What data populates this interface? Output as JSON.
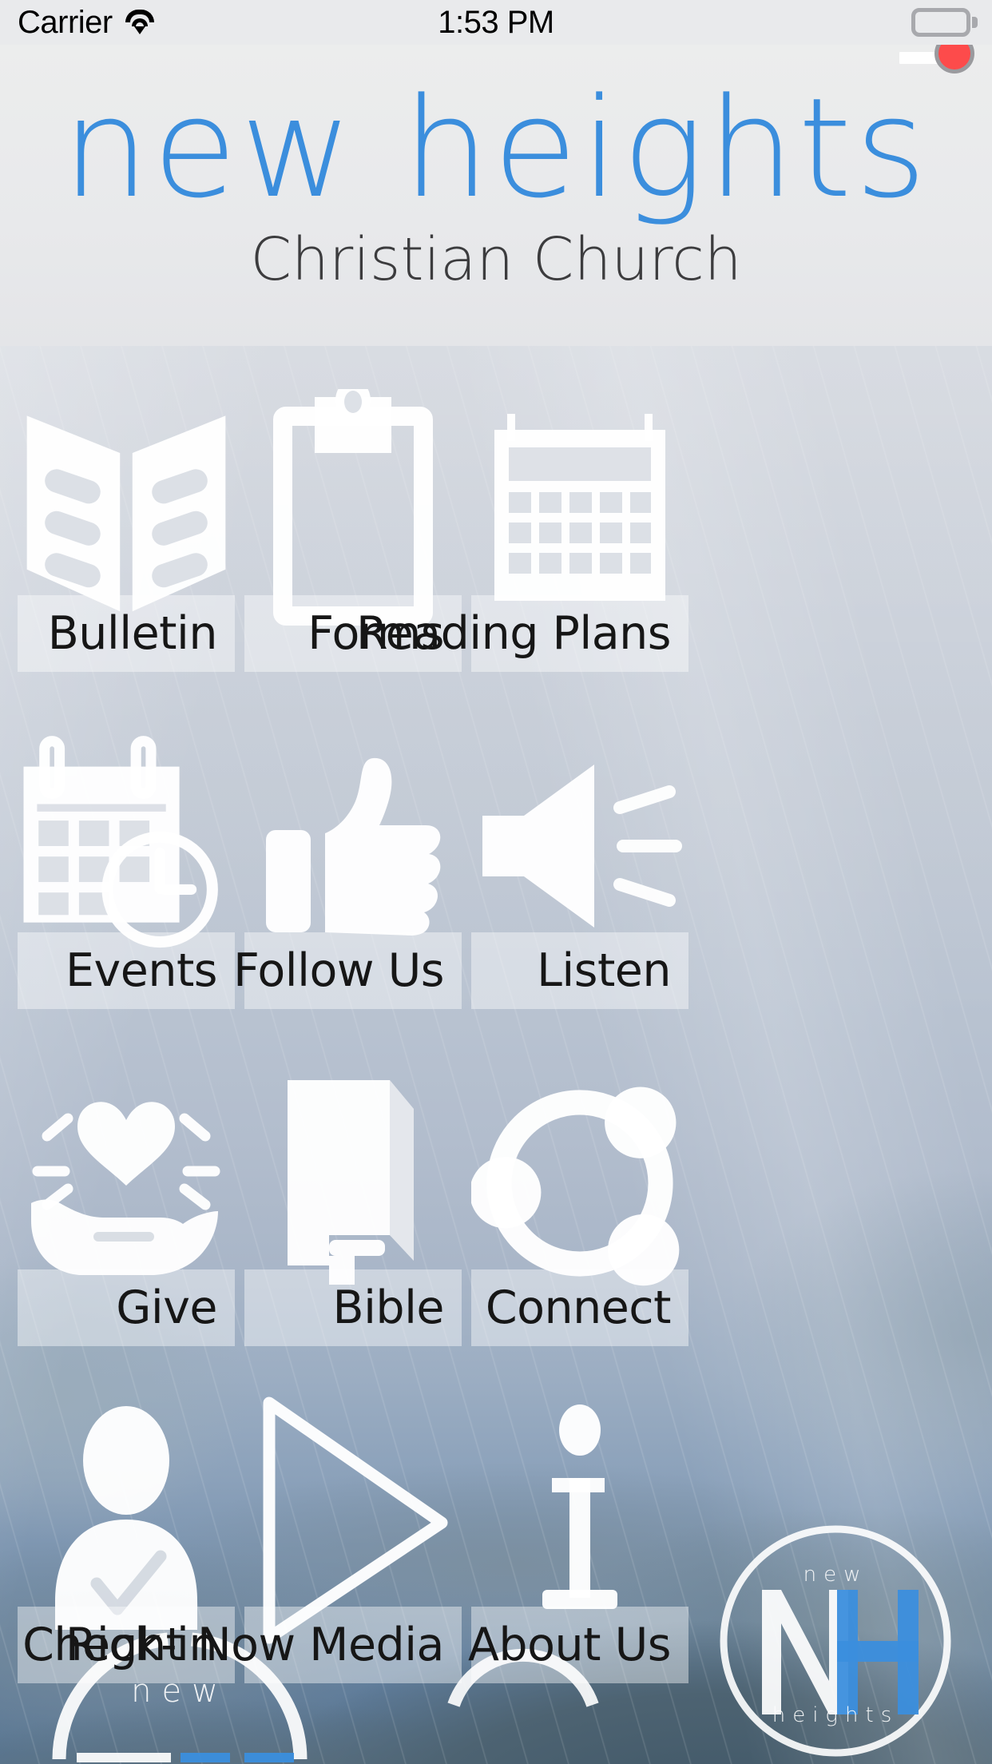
{
  "status_bar": {
    "carrier": "Carrier",
    "time": "1:53 PM",
    "wifi_icon": "wifi-icon",
    "battery_icon": "battery-full-icon"
  },
  "header": {
    "brand_title": "new heights",
    "brand_subtitle": "Christian Church",
    "brand_color": "#3b8edd",
    "subtitle_color": "#3c3c3e",
    "menu_icon": "hamburger-menu-icon",
    "menu_badge_color": "#fd4b4b"
  },
  "grid": {
    "tiles": [
      {
        "label": "Bulletin",
        "icon": "open-book-icon"
      },
      {
        "label": "Forms",
        "icon": "clipboard-icon"
      },
      {
        "label": "Reading Plans",
        "icon": "calendar-grid-icon"
      },
      {
        "label": "Events",
        "icon": "calendar-clock-icon"
      },
      {
        "label": "Follow Us",
        "icon": "thumbs-up-icon"
      },
      {
        "label": "Listen",
        "icon": "speaker-sound-icon"
      },
      {
        "label": "Give",
        "icon": "hand-heart-icon"
      },
      {
        "label": "Bible",
        "icon": "closed-book-icon"
      },
      {
        "label": "Connect",
        "icon": "connect-circle-icon"
      },
      {
        "label": "Check-in",
        "icon": "person-check-icon"
      },
      {
        "label": "Right Now Media",
        "icon": "play-triangle-icon"
      },
      {
        "label": "About Us",
        "icon": "info-i-icon"
      }
    ]
  },
  "watermarks": {
    "left": {
      "text": "new",
      "icon": "new-heights-arc-logo"
    },
    "middle": {
      "icon": "new-heights-arc-small"
    },
    "right": {
      "top_text": "new",
      "monogram_n": "N",
      "monogram_h": "H",
      "bottom_text": "heights",
      "accent_color": "#3b8edd",
      "icon": "new-heights-circle-logo"
    }
  }
}
